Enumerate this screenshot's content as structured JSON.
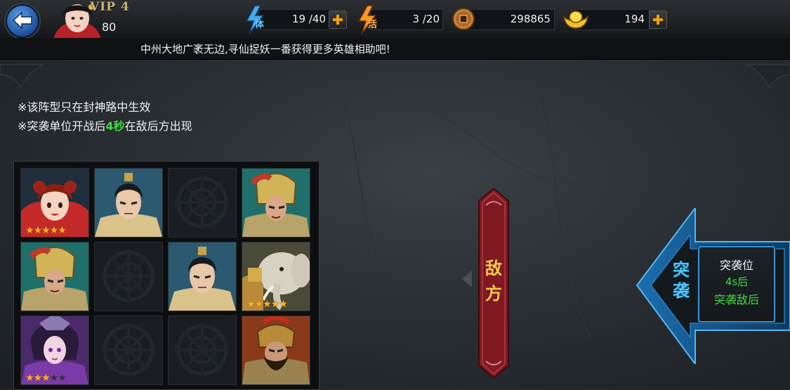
{
  "header": {
    "vip": "VIP 4",
    "level": "80",
    "stamina": {
      "icon": "lightning-stamina-icon",
      "label": "体",
      "value": "19 /40"
    },
    "vigor": {
      "icon": "lightning-vigor-icon",
      "label": "活",
      "value": "3 /20"
    },
    "coins": {
      "icon": "copper-coin-icon",
      "value": "298865"
    },
    "ingots": {
      "icon": "gold-ingot-icon",
      "value": "194"
    }
  },
  "marquee": "中州大地广袤无边,寻仙捉妖一番获得更多英雄相助吧!",
  "notes": {
    "line1": "※该阵型只在封神路中生效",
    "line2_pre": "※突袭单位开战后",
    "line2_hl": "4秒",
    "line2_post": "在敌后方出现"
  },
  "formation": [
    {
      "slot": 1,
      "hero": "red-haired-girl",
      "stars": 5
    },
    {
      "slot": 2,
      "hero": "young-warrior",
      "stars": 0
    },
    {
      "slot": 3,
      "hero": null,
      "stars": 0
    },
    {
      "slot": 4,
      "hero": "armored-general",
      "stars": 0
    },
    {
      "slot": 5,
      "hero": "armored-general",
      "stars": 0
    },
    {
      "slot": 6,
      "hero": null,
      "stars": 0
    },
    {
      "slot": 7,
      "hero": "young-warrior",
      "stars": 0
    },
    {
      "slot": 8,
      "hero": "white-elephant",
      "stars": 5
    },
    {
      "slot": 9,
      "hero": "purple-sorceress",
      "stars": 3
    },
    {
      "slot": 10,
      "hero": null,
      "stars": 0
    },
    {
      "slot": 11,
      "hero": null,
      "stars": 0
    },
    {
      "slot": 12,
      "hero": "bearded-warlord",
      "stars": 0
    }
  ],
  "enemy_banner": {
    "line1": "敌",
    "line2": "方"
  },
  "raid": {
    "arrow_label_1": "突",
    "arrow_label_2": "袭",
    "box_title": "突袭位",
    "box_time": "4s后",
    "box_desc": "突袭敌后"
  },
  "colors": {
    "highlight_green": "#3fdc3f",
    "raid_blue": "#3a8fd0",
    "banner_red": "#8a1c24",
    "star_gold": "#ffb21a"
  }
}
